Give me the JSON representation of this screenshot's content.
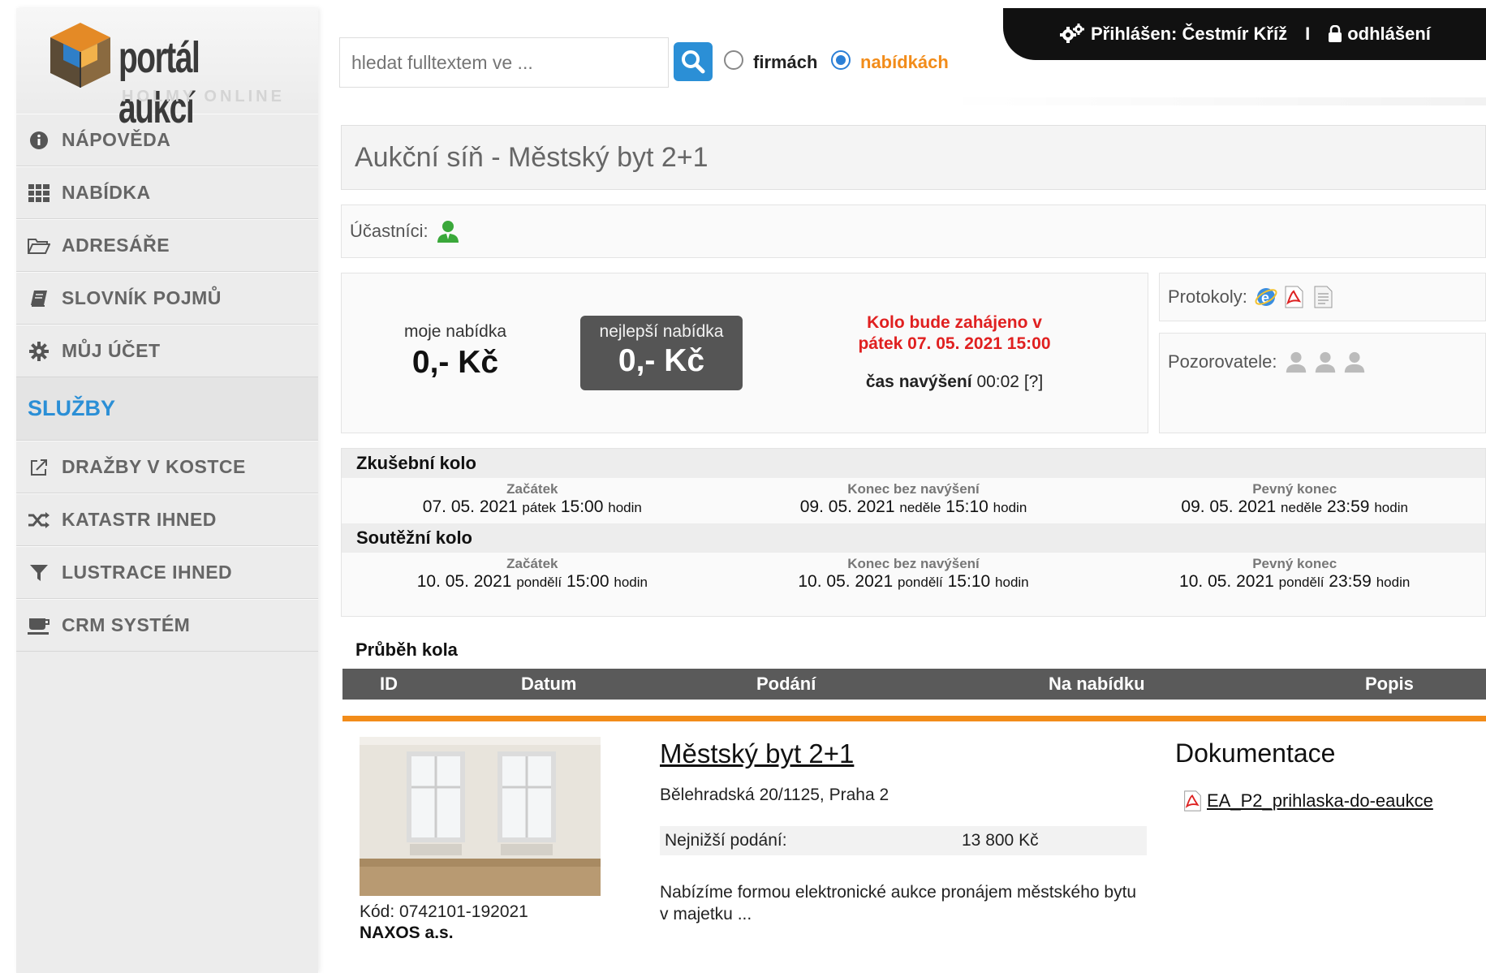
{
  "logo": {
    "text": "portál aukcí",
    "sub": "HOLMY ONLINE"
  },
  "sidebar": {
    "items": [
      {
        "label": "NÁPOVĚDA",
        "icon": "info-icon"
      },
      {
        "label": "NABÍDKA",
        "icon": "grid-icon"
      },
      {
        "label": "ADRESÁŘE",
        "icon": "folder-icon"
      },
      {
        "label": "SLOVNÍK POJMŮ",
        "icon": "book-icon"
      },
      {
        "label": "MŮJ ÚČET",
        "icon": "gear-icon"
      }
    ],
    "section": "SLUŽBY",
    "services": [
      {
        "label": "DRAŽBY V KOSTCE",
        "icon": "external-link-icon"
      },
      {
        "label": "KATASTR IHNED",
        "icon": "shuffle-icon"
      },
      {
        "label": "LUSTRACE IHNED",
        "icon": "filter-icon"
      },
      {
        "label": "CRM SYSTÉM",
        "icon": "coffee-icon"
      }
    ]
  },
  "search": {
    "placeholder": "hledat fulltextem ve ...",
    "opt1": "firmách",
    "opt2": "nabídkách",
    "selected": "nabídkách"
  },
  "user": {
    "logged": "Přihlášen: Čestmír Kříž",
    "sep": "I",
    "logout": "odhlášení"
  },
  "page": {
    "title": "Aukční síň - Městský byt 2+1"
  },
  "participants": {
    "label": "Účastníci:"
  },
  "protocols": {
    "label": "Protokoly:"
  },
  "observers": {
    "label": "Pozorovatele:"
  },
  "bid": {
    "my_label": "moje nabídka",
    "my_value": "0,- Kč",
    "best_label": "nejlepší nabídka",
    "best_value": "0,- Kč",
    "start_line1": "Kolo bude zahájeno v",
    "start_line2": "pátek 07. 05. 2021 15:00",
    "inc_label": "čas navýšení",
    "inc_value": "00:02 [?]"
  },
  "rounds": [
    {
      "name": "Zkušební kolo",
      "cols": [
        {
          "k": "Začátek",
          "date": "07. 05. 2021",
          "day": "pátek",
          "time": "15:00",
          "unit": "hodin"
        },
        {
          "k": "Konec bez navýšení",
          "date": "09. 05. 2021",
          "day": "neděle",
          "time": "15:10",
          "unit": "hodin"
        },
        {
          "k": "Pevný konec",
          "date": "09. 05. 2021",
          "day": "neděle",
          "time": "23:59",
          "unit": "hodin"
        }
      ]
    },
    {
      "name": "Soutěžní kolo",
      "cols": [
        {
          "k": "Začátek",
          "date": "10. 05. 2021",
          "day": "pondělí",
          "time": "15:00",
          "unit": "hodin"
        },
        {
          "k": "Konec bez navýšení",
          "date": "10. 05. 2021",
          "day": "pondělí",
          "time": "15:10",
          "unit": "hodin"
        },
        {
          "k": "Pevný konec",
          "date": "10. 05. 2021",
          "day": "pondělí",
          "time": "23:59",
          "unit": "hodin"
        }
      ]
    }
  ],
  "progress": {
    "title": "Průběh kola",
    "cols": [
      "ID",
      "Datum",
      "Podání",
      "Na nabídku",
      "Popis"
    ]
  },
  "item": {
    "title": "Městský byt 2+1",
    "address": "Bělehradská 20/1125, Praha 2",
    "min_label": "Nejnižší podání:",
    "min_value": "13 800 Kč",
    "desc": "Nabízíme formou elektronické aukce pronájem městského bytu v majetku ...",
    "code": "Kód: 0742101-192021",
    "company": "NAXOS a.s."
  },
  "docs": {
    "title": "Dokumentace",
    "file": "EA_P2_prihlaska-do-eaukce"
  },
  "colors": {
    "accent": "#2b8fd6",
    "orange": "#f28c1a",
    "red": "#e02020"
  }
}
